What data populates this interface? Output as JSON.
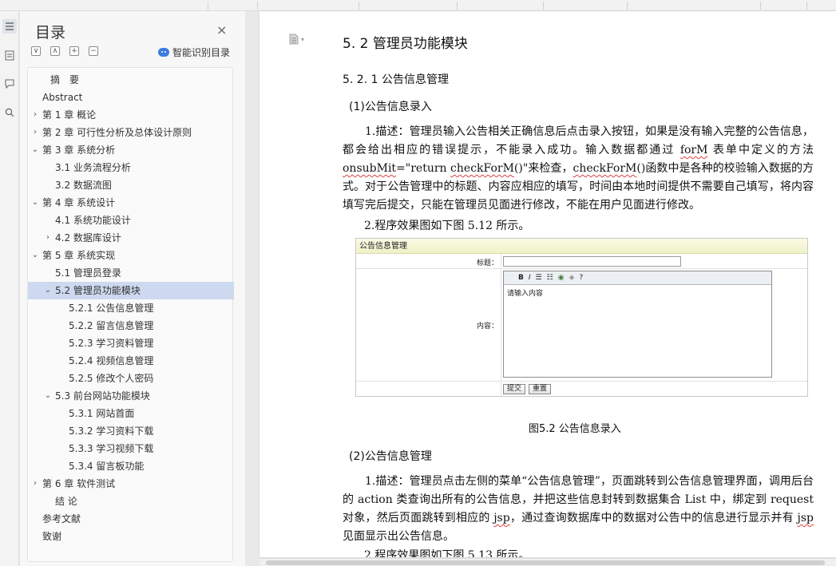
{
  "toc": {
    "title": "目录",
    "close_glyph": "×",
    "tools": [
      "∨",
      "∧",
      "+",
      "−"
    ],
    "smart_label": "智能识别目录",
    "items": [
      {
        "label": "摘　要"
      },
      {
        "label": "Abstract"
      },
      {
        "label": "第 1 章  概论",
        "chevron": "›"
      },
      {
        "label": "第 2 章  可行性分析及总体设计原则",
        "chevron": "›"
      },
      {
        "label": "第 3 章  系统分析",
        "chevron": "⌄"
      },
      {
        "label": "3.1 业务流程分析"
      },
      {
        "label": "3.2 数据流图"
      },
      {
        "label": "第 4 章  系统设计",
        "chevron": "⌄"
      },
      {
        "label": "4.1 系统功能设计"
      },
      {
        "label": "4.2 数据库设计",
        "chevron": "›"
      },
      {
        "label": "第 5 章  系统实现",
        "chevron": "⌄"
      },
      {
        "label": "5.1 管理员登录"
      },
      {
        "label": "5.2 管理员功能模块",
        "chevron": "⌄",
        "selected": true
      },
      {
        "label": "5.2.1 公告信息管理"
      },
      {
        "label": "5.2.2 留言信息管理"
      },
      {
        "label": "5.2.3 学习资料管理"
      },
      {
        "label": "5.2.4 视频信息管理"
      },
      {
        "label": "5.2.5 修改个人密码"
      },
      {
        "label": "5.3 前台网站功能模块",
        "chevron": "⌄"
      },
      {
        "label": "5.3.1 网站首面"
      },
      {
        "label": "5.3.2 学习资料下载"
      },
      {
        "label": "5.3.3 学习视频下载"
      },
      {
        "label": "5.3.4 留言板功能"
      },
      {
        "label": "第 6 章  软件测试",
        "chevron": "›"
      },
      {
        "label": "结  论"
      },
      {
        "label": "参考文献"
      },
      {
        "label": "致谢"
      }
    ]
  },
  "doc": {
    "h1": "5. 2 管理员功能模块",
    "h2": "5. 2. 1 公告信息管理",
    "sec1": "(1)公告信息录入",
    "para1": {
      "a": "1.描述：管理员输入公告相关正确信息后点击录入按钮，如果是没有输入完整的公告信息，都会给出相应的错误提示，不能录入成功。输入数据都通过 ",
      "b": "forM",
      "c": " 表单中定义的方法 ",
      "d": "onsubMit",
      "e": "=\"return ",
      "f": "checkForM",
      "g": "()\"来检查，",
      "h": "checkForM",
      "i": "()函数中是各种的校验输入数据的方式。对于公告管理中的标题、内容应相应的填写，时间由本地时间提供不需要自己填写，将内容填写完后提交，只能在管理员见面进行修改，不能在用户见面进行修改。"
    },
    "line1": "2.程序效果图如下图 5.12 所示。",
    "screenshot": {
      "header": "公告信息管理",
      "title_label": "标题：",
      "content_label": "内容：",
      "toolbar": [
        "B",
        "I",
        "☰",
        "☷",
        "◉",
        "◈",
        "?"
      ],
      "editor_text": "请输入内容",
      "submit": "提交",
      "reset": "重置"
    },
    "caption": "图5.2 公告信息录入",
    "sec2": "(2)公告信息管理",
    "para2": {
      "a": "1.描述：管理员点击左侧的菜单“公告信息管理”，页面跳转到公告信息管理界面，调用后台的 action 类查询出所有的公告信息，并把这些信息封转到数据集合 List 中，绑定到 request 对象，然后页面跳转到相应的 ",
      "b": "jsp",
      "c": "，通过查询数据库中的数据对公告中的信息进行显示并有 ",
      "d": "jsp",
      "e": " 见面显示出公告信息。"
    },
    "line2": "2.程序效果图如下图 5.13 所示。"
  }
}
